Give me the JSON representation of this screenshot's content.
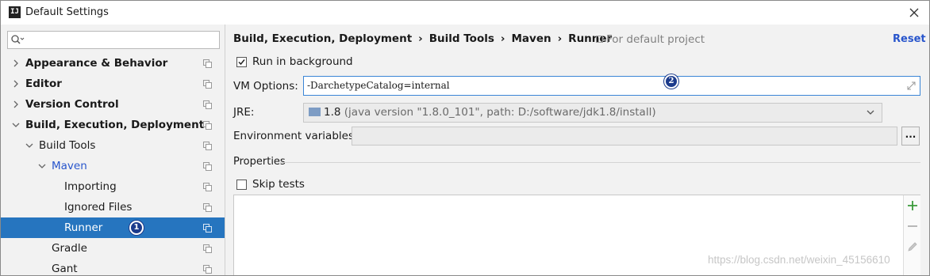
{
  "window": {
    "title": "Default Settings"
  },
  "sidebar": {
    "search": {
      "value": "",
      "placeholder": ""
    },
    "items": [
      {
        "label": "Appearance & Behavior"
      },
      {
        "label": "Editor"
      },
      {
        "label": "Version Control"
      },
      {
        "label": "Build, Execution, Deployment"
      },
      {
        "label": "Build Tools"
      },
      {
        "label": "Maven"
      },
      {
        "label": "Importing"
      },
      {
        "label": "Ignored Files"
      },
      {
        "label": "Runner"
      },
      {
        "label": "Gradle"
      },
      {
        "label": "Gant"
      }
    ],
    "runner_badge": "1"
  },
  "main": {
    "breadcrumb": [
      "Build, Execution, Deployment",
      "Build Tools",
      "Maven",
      "Runner"
    ],
    "breadcrumb_sep": "›",
    "default_project": "For default project",
    "reset_label": "Reset",
    "run_in_background": {
      "label": "Run in background",
      "checked": true
    },
    "vm_options": {
      "label": "VM Options:",
      "value": "-DarchetypeCatalog=internal",
      "badge": "2"
    },
    "jre": {
      "label": "JRE:",
      "version": "1.8",
      "detail": " (java version \"1.8.0_101\", path: D:/software/jdk1.8/install)"
    },
    "env_vars": {
      "label": "Environment variables:",
      "value": "",
      "browse_label": "..."
    },
    "properties": {
      "section_title": "Properties",
      "skip_tests": {
        "label": "Skip tests",
        "checked": false
      }
    }
  },
  "watermark": "https://blog.csdn.net/weixin_45156610",
  "colors": {
    "selection": "#2675bf",
    "link": "#2855cc",
    "badge": "#1c3b8c",
    "add": "#3a9a3a"
  },
  "icons": [
    "app-icon",
    "close-icon",
    "search-icon",
    "chevron-right-icon",
    "chevron-down-icon",
    "copy-icon",
    "expand-icon",
    "folder-icon",
    "add-icon",
    "remove-icon",
    "edit-icon"
  ]
}
